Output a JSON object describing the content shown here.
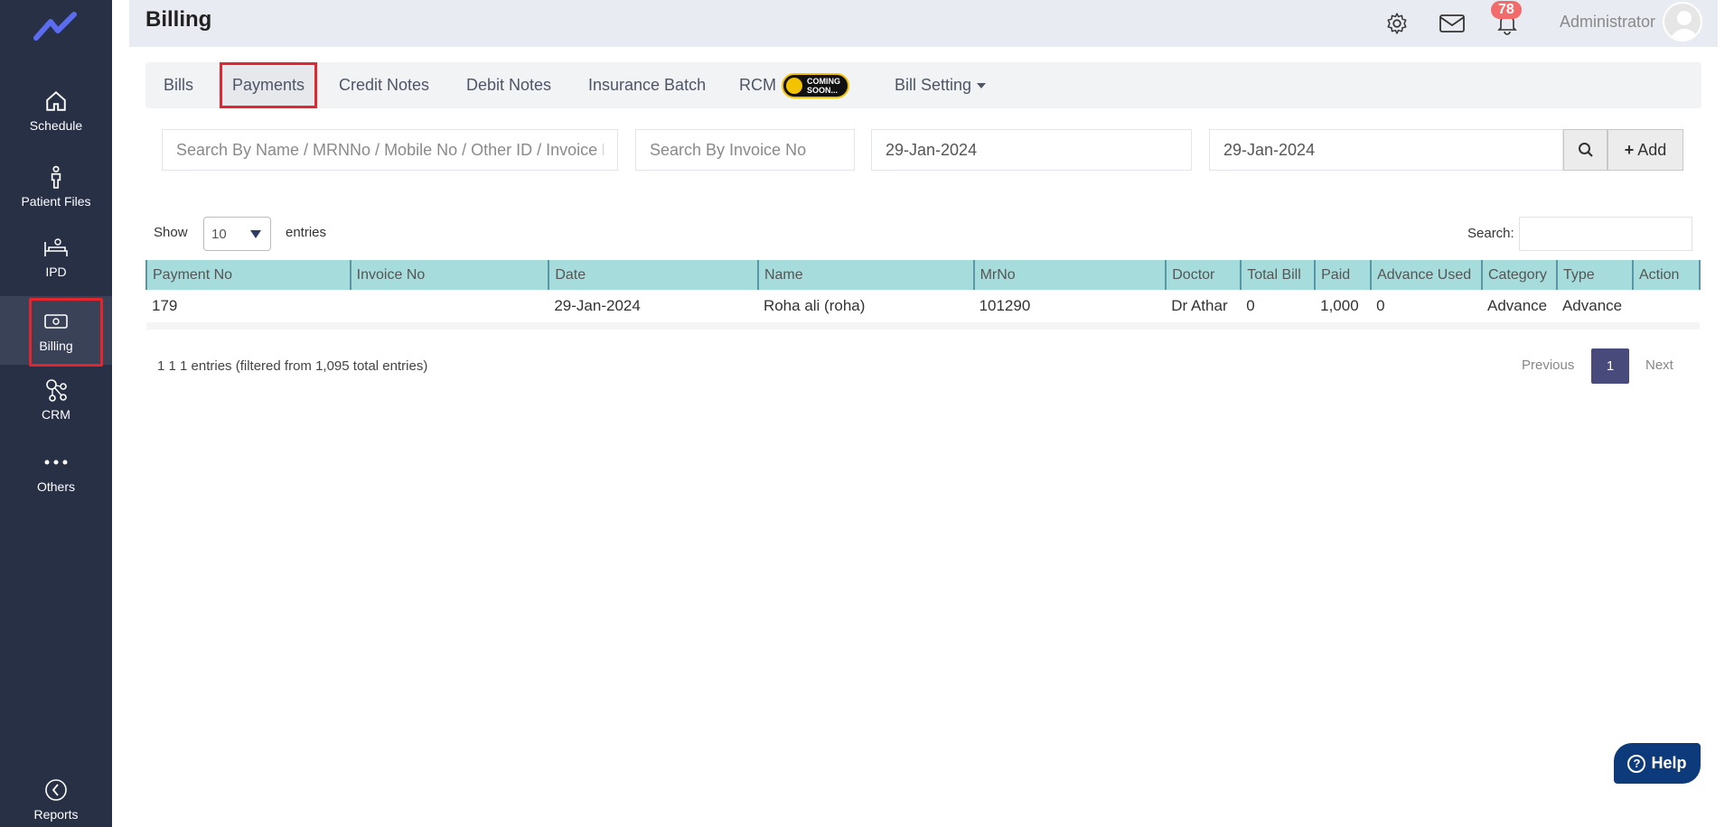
{
  "sidebar": {
    "logo_icon": "trend-line-logo",
    "items": [
      {
        "label": "Schedule",
        "icon": "home-icon"
      },
      {
        "label": "Patient Files",
        "icon": "person-icon"
      },
      {
        "label": "IPD",
        "icon": "bed-icon"
      },
      {
        "label": "Billing",
        "icon": "bill-icon",
        "active": true
      },
      {
        "label": "CRM",
        "icon": "nodes-icon"
      },
      {
        "label": "Others",
        "icon": "dots-icon"
      },
      {
        "label": "Reports",
        "icon": "chart-pie-icon"
      }
    ]
  },
  "header": {
    "title": "Billing",
    "notification_count": "78",
    "user_name": "Administrator"
  },
  "tabs": [
    {
      "label": "Bills"
    },
    {
      "label": "Payments",
      "active": true
    },
    {
      "label": "Credit Notes"
    },
    {
      "label": "Debit Notes"
    },
    {
      "label": "Insurance Batch"
    },
    {
      "label": "RCM",
      "badge": [
        "COMING",
        "SOON..."
      ]
    },
    {
      "label": "Bill Setting"
    }
  ],
  "filters": {
    "name_placeholder": "Search By Name / MRNNo / Mobile No / Other ID / Invoice No",
    "invoice_placeholder": "Search By Invoice No",
    "date_from": "29-Jan-2024",
    "date_to": "29-Jan-2024",
    "add_label": "Add"
  },
  "table_controls": {
    "show_label": "Show",
    "page_size": "10",
    "entries_label": "entries",
    "search_label": "Search:"
  },
  "table": {
    "columns": [
      "Payment No",
      "Invoice No",
      "Date",
      "Name",
      "MrNo",
      "Doctor",
      "Total Bill",
      "Paid",
      "Advance Used",
      "Category",
      "Type",
      "Action"
    ],
    "rows": [
      [
        "179",
        "",
        "29-Jan-2024",
        "Roha ali (roha)",
        "101290",
        "Dr Athar",
        "0",
        "1,000",
        "0",
        "Advance",
        "Advance",
        ""
      ]
    ]
  },
  "pagination": {
    "info": "1 1 1 entries (filtered from 1,095 total entries)",
    "previous": "Previous",
    "current": "1",
    "next": "Next"
  },
  "help": {
    "label": "Help"
  },
  "colors": {
    "sidebar": "#283046",
    "table_header": "#a7dcdc",
    "highlight": "#e3262e",
    "page_active": "#474a7a"
  }
}
